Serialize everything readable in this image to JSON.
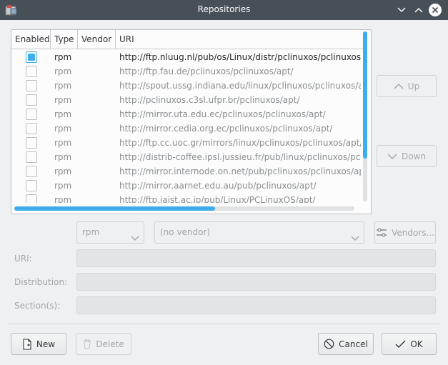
{
  "window": {
    "title": "Repositories"
  },
  "table": {
    "headers": {
      "enabled": "Enabled",
      "type": "Type",
      "vendor": "Vendor",
      "uri": "URI"
    },
    "rows": [
      {
        "enabled": true,
        "type": "rpm",
        "uri": "http://ftp.nluug.nl/pub/os/Linux/distr/pclinuxos/pclinuxos/apt/"
      },
      {
        "enabled": false,
        "type": "rpm",
        "uri": "http://ftp.fau.de/pclinuxos/pclinuxos/apt/"
      },
      {
        "enabled": false,
        "type": "rpm",
        "uri": "http://spout.ussg.indiana.edu/linux/pclinuxos/pclinuxos/apt/"
      },
      {
        "enabled": false,
        "type": "rpm",
        "uri": "http://pclinuxos.c3sl.ufpr.br/pclinuxos/apt/"
      },
      {
        "enabled": false,
        "type": "rpm",
        "uri": "http://mirror.uta.edu.ec/pclinuxos/pclinuxos/apt/"
      },
      {
        "enabled": false,
        "type": "rpm",
        "uri": "http://mirror.cedia.org.ec/pclinuxos/pclinuxos/apt/"
      },
      {
        "enabled": false,
        "type": "rpm",
        "uri": "http://ftp.cc.uoc.gr/mirrors/linux/pclinuxos/pclinuxos/apt/"
      },
      {
        "enabled": false,
        "type": "rpm",
        "uri": "http://distrib-coffee.ipsl.jussieu.fr/pub/linux/pclinuxos/pclinuxos/apt/"
      },
      {
        "enabled": false,
        "type": "rpm",
        "uri": "http://mirror.internode.on.net/pub/pclinuxos/pclinuxos/apt/"
      },
      {
        "enabled": false,
        "type": "rpm",
        "uri": "http://mirror.aarnet.edu.au/pub/pclinuxos/apt/"
      },
      {
        "enabled": false,
        "type": "rpm",
        "uri": "http://ftp.jaist.ac.jp/pub/Linux/PCLinuxOS/apt/"
      }
    ]
  },
  "side_buttons": {
    "up": "Up",
    "down": "Down"
  },
  "editor": {
    "type_combo": "rpm",
    "vendor_combo": "(no vendor)",
    "vendors_button": "Vendors...",
    "uri_label": "URI:",
    "uri_value": "",
    "distribution_label": "Distribution:",
    "distribution_value": "",
    "sections_label": "Section(s):",
    "sections_value": ""
  },
  "footer": {
    "new": "New",
    "delete": "Delete",
    "cancel": "Cancel",
    "ok": "OK"
  },
  "colors": {
    "accent": "#3daee9",
    "titlebar": "#475057",
    "window_bg": "#eff0f1"
  }
}
